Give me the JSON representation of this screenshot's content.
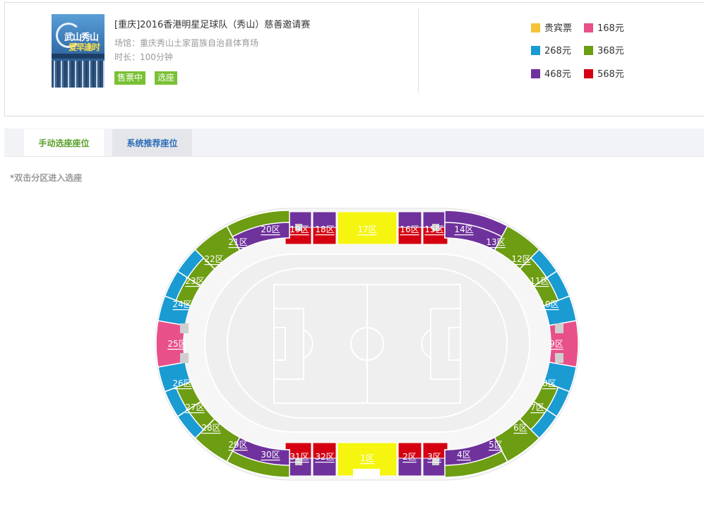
{
  "event": {
    "title": "[重庆]2016香港明星足球队（秀山）慈善邀请赛",
    "venue": "场馆：重庆秀山土家苗族自治县体育场",
    "duration": "时长：100分钟",
    "tag_on_sale": "售票中",
    "tag_pick_seat": "选座",
    "poster": {
      "line1": "武山秀山",
      "line2": "爱早逢时"
    }
  },
  "legend": [
    {
      "label": "贵宾票",
      "color": "#f5c33b"
    },
    {
      "label": "168元",
      "color": "#e8508a"
    },
    {
      "label": "268元",
      "color": "#1a9bd2"
    },
    {
      "label": "368元",
      "color": "#6c9d12"
    },
    {
      "label": "468元",
      "color": "#6f329c"
    },
    {
      "label": "568元",
      "color": "#d40011"
    }
  ],
  "tabs": {
    "manual": "手动选座座位",
    "system": "系统推荐座位"
  },
  "hint": "*双击分区进入选座",
  "zones": {
    "z1": "1区",
    "z2": "2区",
    "z3": "3区",
    "z4": "4区",
    "z5": "5区",
    "z6": "6区",
    "z7": "7区",
    "z8": "8区",
    "z9": "9区",
    "z10": "10区",
    "z11": "11区",
    "z12": "12区",
    "z13": "13区",
    "z14": "14区",
    "z15": "15区",
    "z16": "16区",
    "z17": "17区",
    "z18": "18区",
    "z19": "19区",
    "z20": "20区",
    "z21": "21区",
    "z22": "22区",
    "z23": "23区",
    "z24": "24区",
    "z25": "25区",
    "z26": "26区",
    "z27": "27区",
    "z28": "28区",
    "z29": "29区",
    "z30": "30区",
    "z31": "31区",
    "z32": "32区"
  },
  "colors": {
    "vip": "#f5f510",
    "pink": "#e8508a",
    "blue": "#1a9bd2",
    "green": "#6c9d12",
    "purple": "#6f329c",
    "red": "#d40011"
  }
}
